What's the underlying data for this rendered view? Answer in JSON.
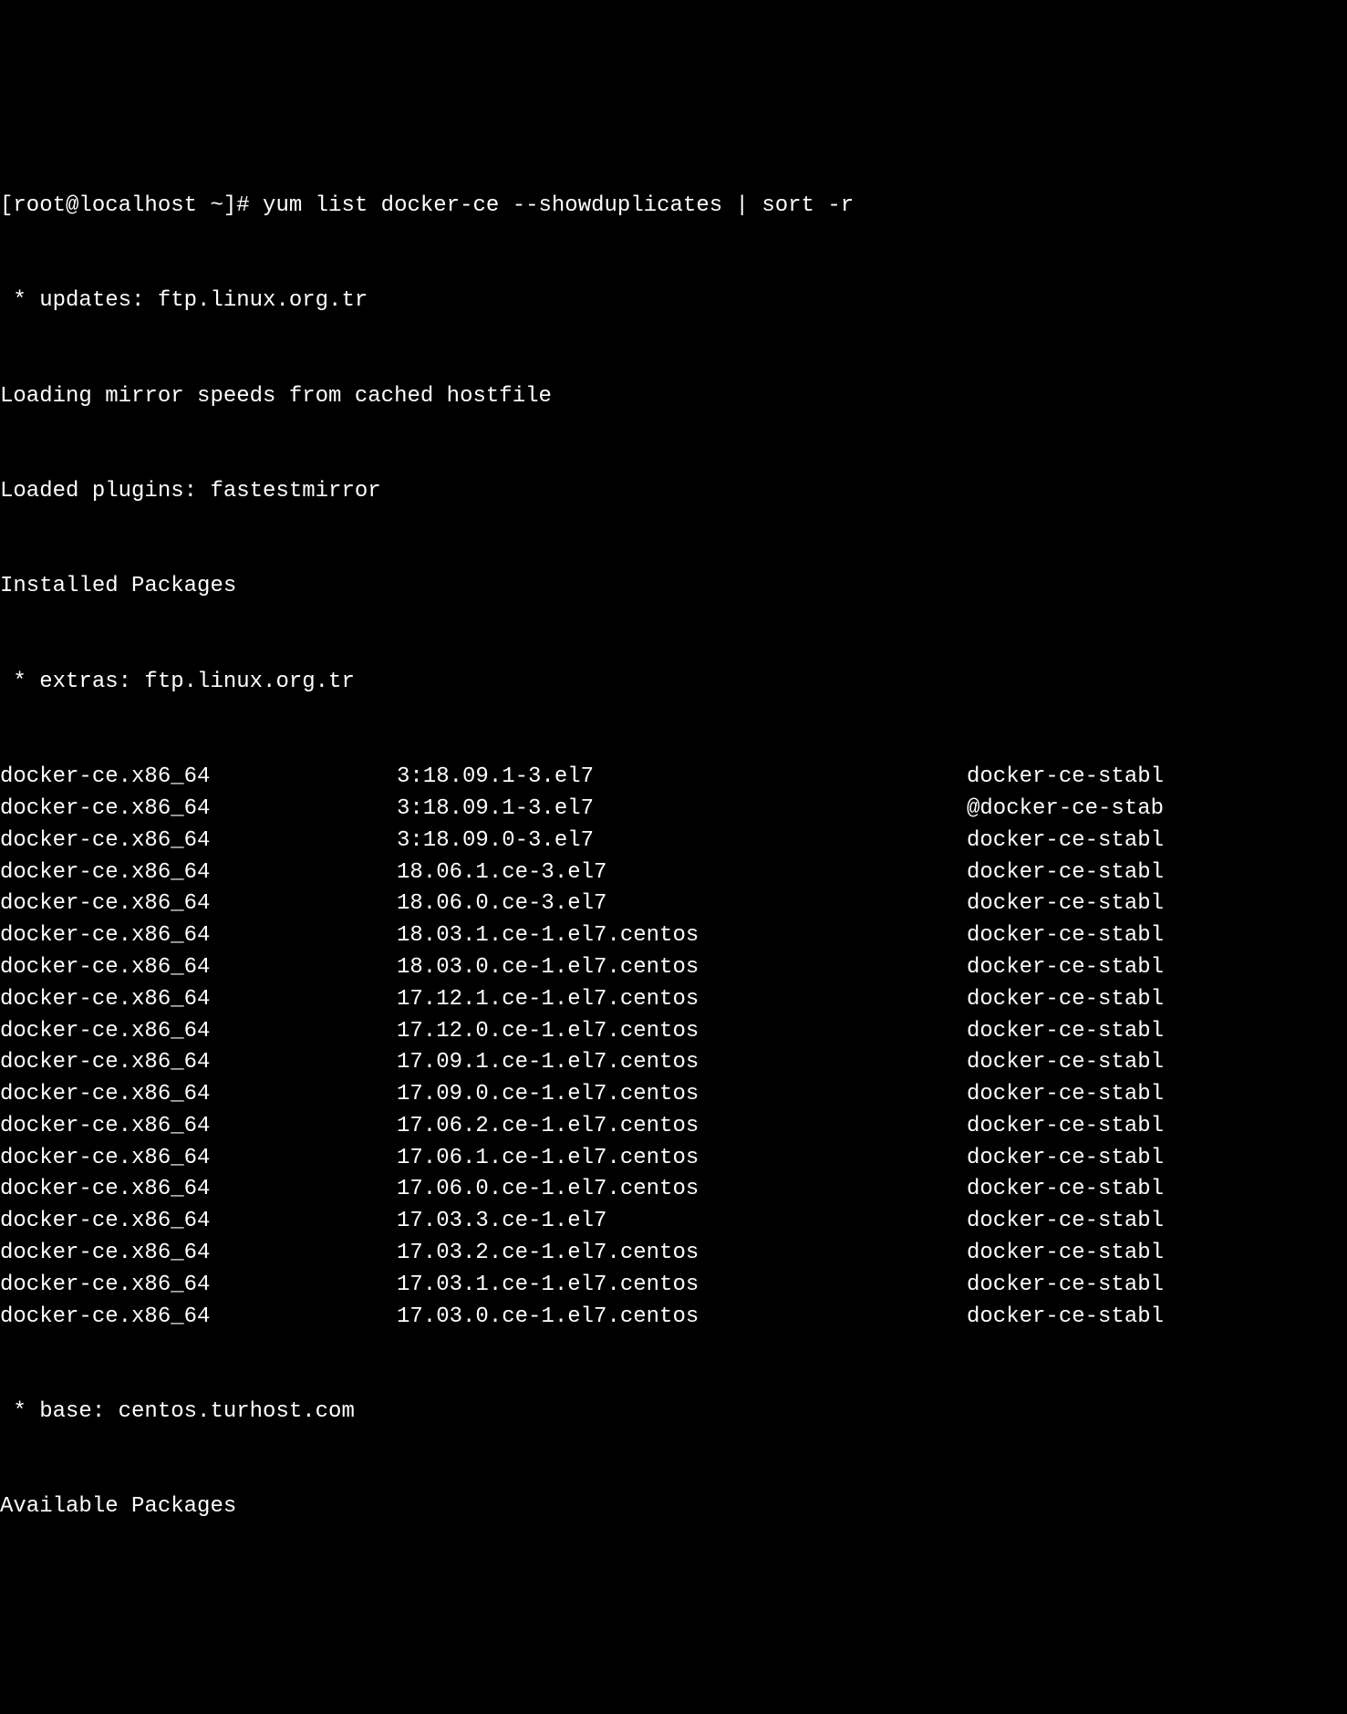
{
  "prompt": "[root@localhost ~]# ",
  "command": "yum list docker-ce --showduplicates | sort -r",
  "lines": {
    "updates": " * updates: ftp.linux.org.tr",
    "loading_mirror": "Loading mirror speeds from cached hostfile",
    "loaded_plugins": "Loaded plugins: fastestmirror",
    "installed_packages": "Installed Packages",
    "extras": " * extras: ftp.linux.org.tr",
    "base": " * base: centos.turhost.com",
    "available_packages": "Available Packages"
  },
  "packages": [
    {
      "name": "docker-ce.x86_64",
      "version": "3:18.09.1-3.el7",
      "repo": "docker-ce-stabl"
    },
    {
      "name": "docker-ce.x86_64",
      "version": "3:18.09.1-3.el7",
      "repo": "@docker-ce-stab"
    },
    {
      "name": "docker-ce.x86_64",
      "version": "3:18.09.0-3.el7",
      "repo": "docker-ce-stabl"
    },
    {
      "name": "docker-ce.x86_64",
      "version": "18.06.1.ce-3.el7",
      "repo": "docker-ce-stabl"
    },
    {
      "name": "docker-ce.x86_64",
      "version": "18.06.0.ce-3.el7",
      "repo": "docker-ce-stabl"
    },
    {
      "name": "docker-ce.x86_64",
      "version": "18.03.1.ce-1.el7.centos",
      "repo": "docker-ce-stabl"
    },
    {
      "name": "docker-ce.x86_64",
      "version": "18.03.0.ce-1.el7.centos",
      "repo": "docker-ce-stabl"
    },
    {
      "name": "docker-ce.x86_64",
      "version": "17.12.1.ce-1.el7.centos",
      "repo": "docker-ce-stabl"
    },
    {
      "name": "docker-ce.x86_64",
      "version": "17.12.0.ce-1.el7.centos",
      "repo": "docker-ce-stabl"
    },
    {
      "name": "docker-ce.x86_64",
      "version": "17.09.1.ce-1.el7.centos",
      "repo": "docker-ce-stabl"
    },
    {
      "name": "docker-ce.x86_64",
      "version": "17.09.0.ce-1.el7.centos",
      "repo": "docker-ce-stabl"
    },
    {
      "name": "docker-ce.x86_64",
      "version": "17.06.2.ce-1.el7.centos",
      "repo": "docker-ce-stabl"
    },
    {
      "name": "docker-ce.x86_64",
      "version": "17.06.1.ce-1.el7.centos",
      "repo": "docker-ce-stabl"
    },
    {
      "name": "docker-ce.x86_64",
      "version": "17.06.0.ce-1.el7.centos",
      "repo": "docker-ce-stabl"
    },
    {
      "name": "docker-ce.x86_64",
      "version": "17.03.3.ce-1.el7",
      "repo": "docker-ce-stabl"
    },
    {
      "name": "docker-ce.x86_64",
      "version": "17.03.2.ce-1.el7.centos",
      "repo": "docker-ce-stabl"
    },
    {
      "name": "docker-ce.x86_64",
      "version": "17.03.1.ce-1.el7.centos",
      "repo": "docker-ce-stabl"
    },
    {
      "name": "docker-ce.x86_64",
      "version": "17.03.0.ce-1.el7.centos",
      "repo": "docker-ce-stabl"
    }
  ]
}
